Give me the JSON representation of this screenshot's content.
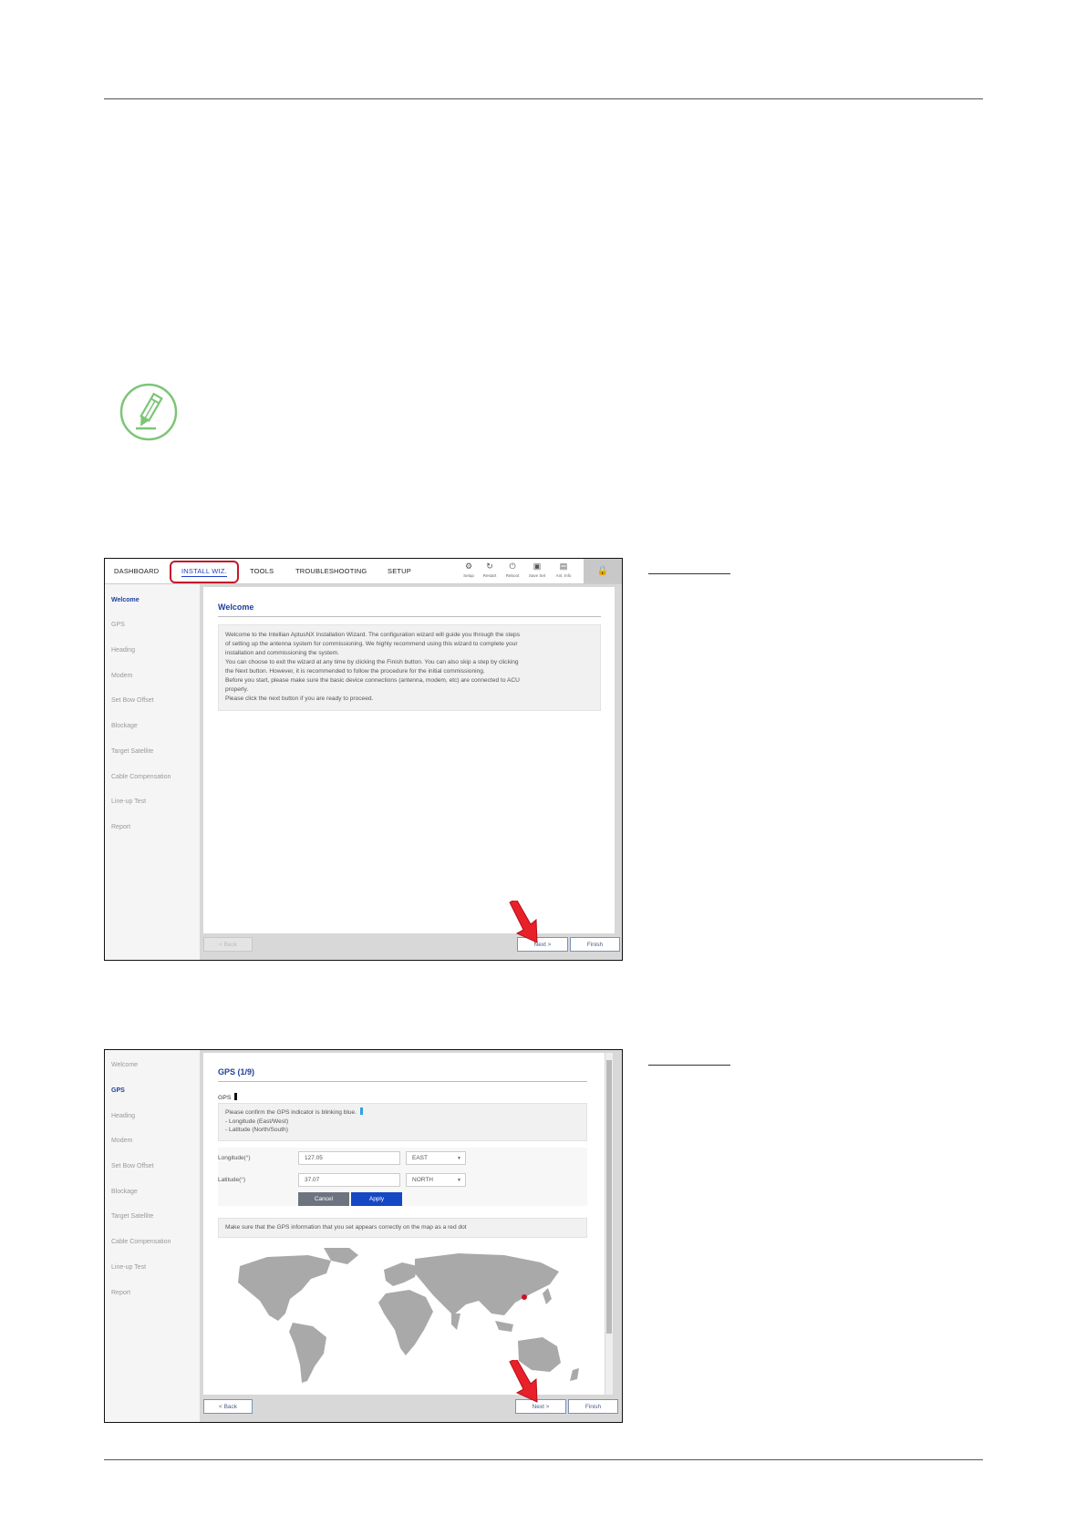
{
  "screenshot1": {
    "nav": {
      "items": [
        "DASHBOARD",
        "INSTALL WIZ.",
        "TOOLS",
        "TROUBLESHOOTING",
        "SETUP"
      ],
      "tools": [
        {
          "label": "Setup",
          "icon": "gear-icon"
        },
        {
          "label": "Restart",
          "icon": "restart-icon"
        },
        {
          "label": "Reboot",
          "icon": "power-icon"
        },
        {
          "label": "Save Set",
          "icon": "save-icon"
        },
        {
          "label": "Ant. Info",
          "icon": "info-icon"
        }
      ]
    },
    "sidebar": [
      "Welcome",
      "GPS",
      "Heading",
      "Modem",
      "Set Bow Offset",
      "Blockage",
      "Target Satellite",
      "Cable Compensation",
      "Line-up Test",
      "Report"
    ],
    "panel": {
      "title": "Welcome",
      "lines": [
        "Welcome to the Intellian AptusNX Installation Wizard. The configuration wizard will guide you through the steps",
        "of setting up the antenna system for commissioning. We highly recommend using this wizard to complete your",
        "installation and commissioning the system.",
        "You can choose to exit the wizard at any time by clicking the Finish button. You can also skip a step by clicking",
        "the Next button. However, it is recommended to follow the procedure for the initial commissioning.",
        "Before you start, please make sure the basic device connections (antenna, modem, etc) are connected to ACU",
        "properly.",
        "Please click the next button if you are ready to proceed."
      ]
    },
    "buttons": {
      "back": "< Back",
      "next": "Next >",
      "finish": "Finish"
    }
  },
  "screenshot2": {
    "sidebar": [
      "Welcome",
      "GPS",
      "Heading",
      "Modem",
      "Set Bow Offset",
      "Blockage",
      "Target Satellite",
      "Cable Compensation",
      "Line-up Test",
      "Report"
    ],
    "panel": {
      "title": "GPS (1/9)",
      "gps_label": "GPS",
      "info_lines": [
        "Please confirm the GPS indicator is blinking blue.",
        "- Longitude (East/West)",
        "- Latitude (North/South)"
      ],
      "longitude_label": "Longitude(°)",
      "longitude_value": "127.05",
      "longitude_dir": "EAST",
      "latitude_label": "Latitude(°)",
      "latitude_value": "37.07",
      "latitude_dir": "NORTH",
      "cancel_label": "Cancel",
      "apply_label": "Apply",
      "map_note": "Make sure that the GPS information that you set appears correctly on the map as a red dot"
    },
    "buttons": {
      "back": "< Back",
      "next": "Next >",
      "finish": "Finish"
    }
  },
  "colors": {
    "accent": "#1e3f9c",
    "highlight": "#c2182b",
    "apply": "#1447c4",
    "cancel": "#6d7480",
    "note_icon": "#7cc576"
  }
}
